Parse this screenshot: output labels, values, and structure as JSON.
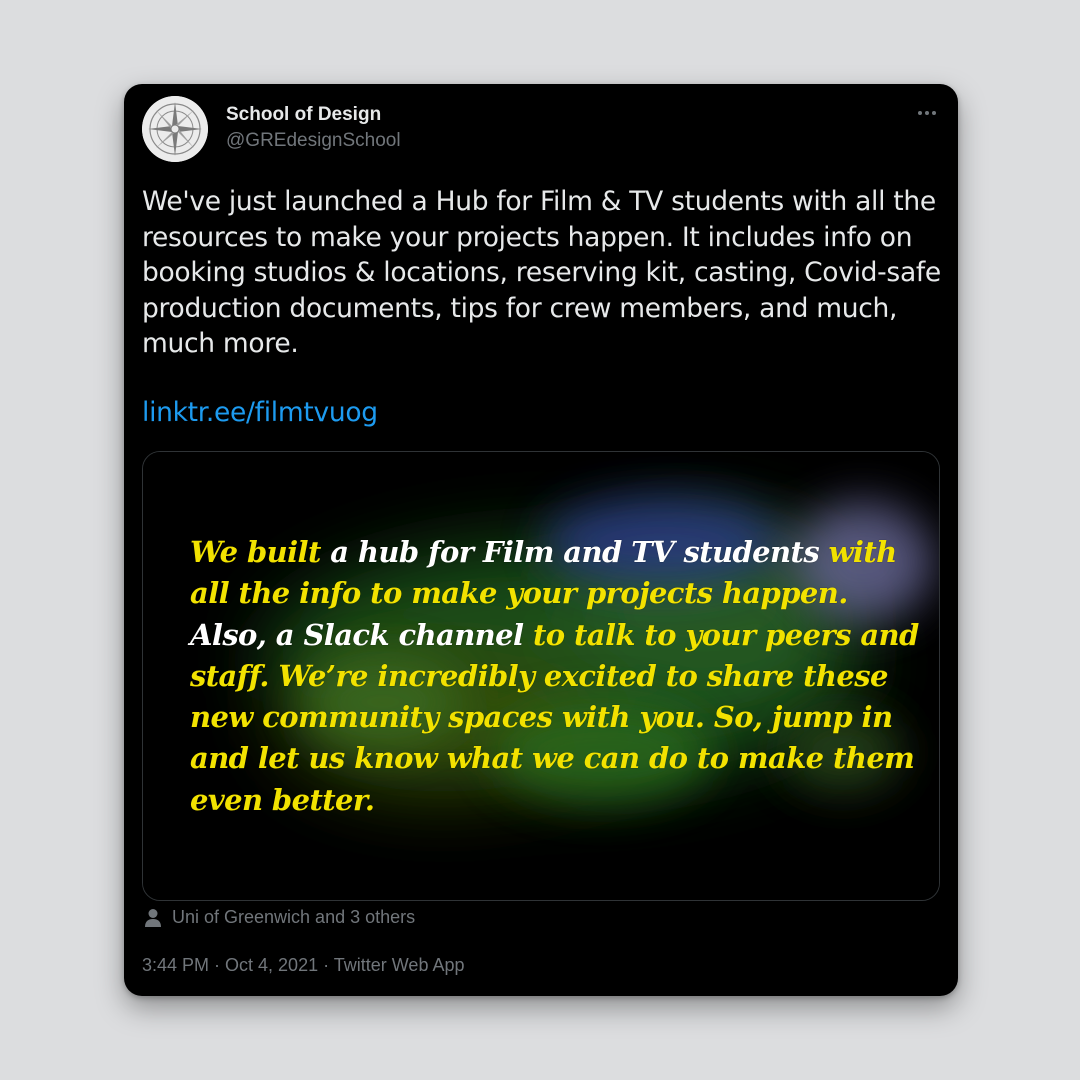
{
  "account": {
    "display_name": "School of Design",
    "handle": "@GREdesignSchool",
    "avatar_icon": "compass-rose-logo"
  },
  "more_icon": "more-horizontal-icon",
  "tweet": {
    "text": "We've just launched a Hub for Film & TV students with all the resources to make your projects happen. It includes info on booking studios & locations, reserving kit, casting, Covid-safe production documents, tips for crew members, and much, much more.",
    "link": "linktr.ee/filmtvuog"
  },
  "media": {
    "segments": [
      {
        "text": "We built ",
        "color": "yellow"
      },
      {
        "text": "a hub for Film and TV students ",
        "color": "white"
      },
      {
        "text": "with all the info to make your projects happen. ",
        "color": "yellow"
      },
      {
        "text": "Also, a Slack channel ",
        "color": "white"
      },
      {
        "text": "to talk to your peers and staff. We’re incredibly excited to share these new community spaces  with you. So, jump in  and let us know what we can do to make them even better.",
        "color": "yellow"
      }
    ]
  },
  "social_context": {
    "icon": "person-icon",
    "text": "Uni of Greenwich and 3 others"
  },
  "meta": {
    "text": "3:44 PM · Oct 4, 2021 · Twitter Web App"
  },
  "colors": {
    "background": "#dcdddf",
    "card": "#000000",
    "text_primary": "#e7e9ea",
    "text_secondary": "#71767b",
    "link": "#1d9bf0",
    "media_yellow": "#f2e200",
    "media_white": "#ffffff"
  }
}
